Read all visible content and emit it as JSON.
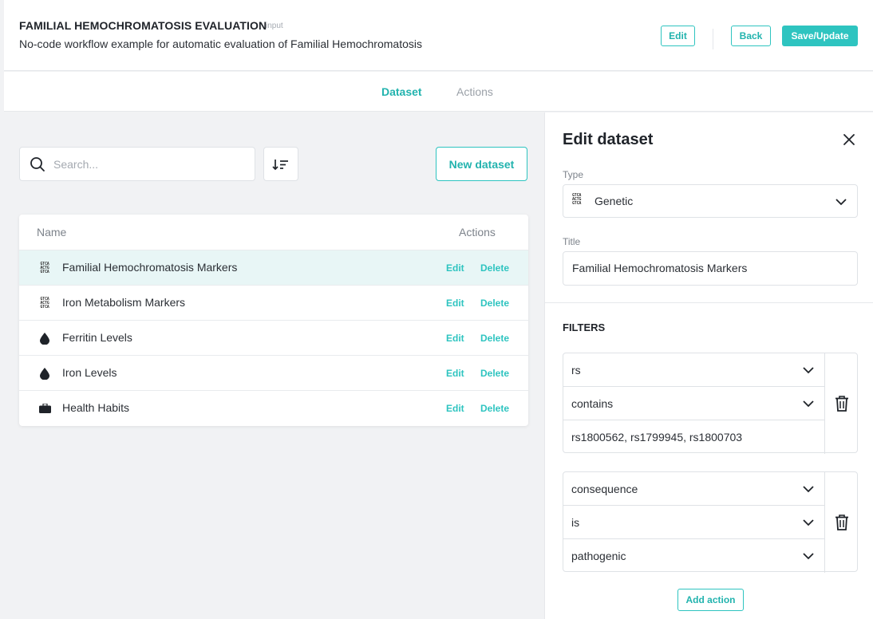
{
  "header": {
    "title": "FAMILIAL HEMOCHROMATOSIS EVALUATION",
    "tag": "input",
    "subtitle": "No-code workflow example for automatic evaluation of Familial Hemochromatosis",
    "edit_label": "Edit",
    "back_label": "Back",
    "save_label": "Save/Update"
  },
  "tabs": [
    {
      "label": "Dataset",
      "active": true
    },
    {
      "label": "Actions",
      "active": false
    }
  ],
  "toolbar": {
    "search_placeholder": "Search...",
    "new_dataset_label": "New dataset"
  },
  "table": {
    "columns": {
      "name": "Name",
      "actions": "Actions"
    },
    "rows": [
      {
        "name": "Familial Hemochromatosis Markers",
        "icon": "dna-icon",
        "edit": "Edit",
        "delete": "Delete",
        "selected": true
      },
      {
        "name": "Iron Metabolism Markers",
        "icon": "dna-icon",
        "edit": "Edit",
        "delete": "Delete",
        "selected": false
      },
      {
        "name": "Ferritin Levels",
        "icon": "blood-drop-icon",
        "edit": "Edit",
        "delete": "Delete",
        "selected": false
      },
      {
        "name": "Iron Levels",
        "icon": "blood-drop-icon",
        "edit": "Edit",
        "delete": "Delete",
        "selected": false
      },
      {
        "name": "Health Habits",
        "icon": "briefcase-icon",
        "edit": "Edit",
        "delete": "Delete",
        "selected": false
      }
    ]
  },
  "panel": {
    "title": "Edit dataset",
    "type_label": "Type",
    "type_value": "Genetic",
    "title_label": "Title",
    "title_value": "Familial Hemochromatosis Markers",
    "filters_heading": "FILTERS",
    "filters": [
      {
        "field": "rs",
        "operator": "contains",
        "value": "rs1800562, rs1799945, rs1800703"
      },
      {
        "field": "consequence",
        "operator": "is",
        "value": "pathogenic"
      }
    ],
    "add_action_label": "Add action"
  },
  "colors": {
    "accent": "#2ec4c0",
    "selected_row": "#e8f6f6",
    "background": "#f1f2f4"
  }
}
